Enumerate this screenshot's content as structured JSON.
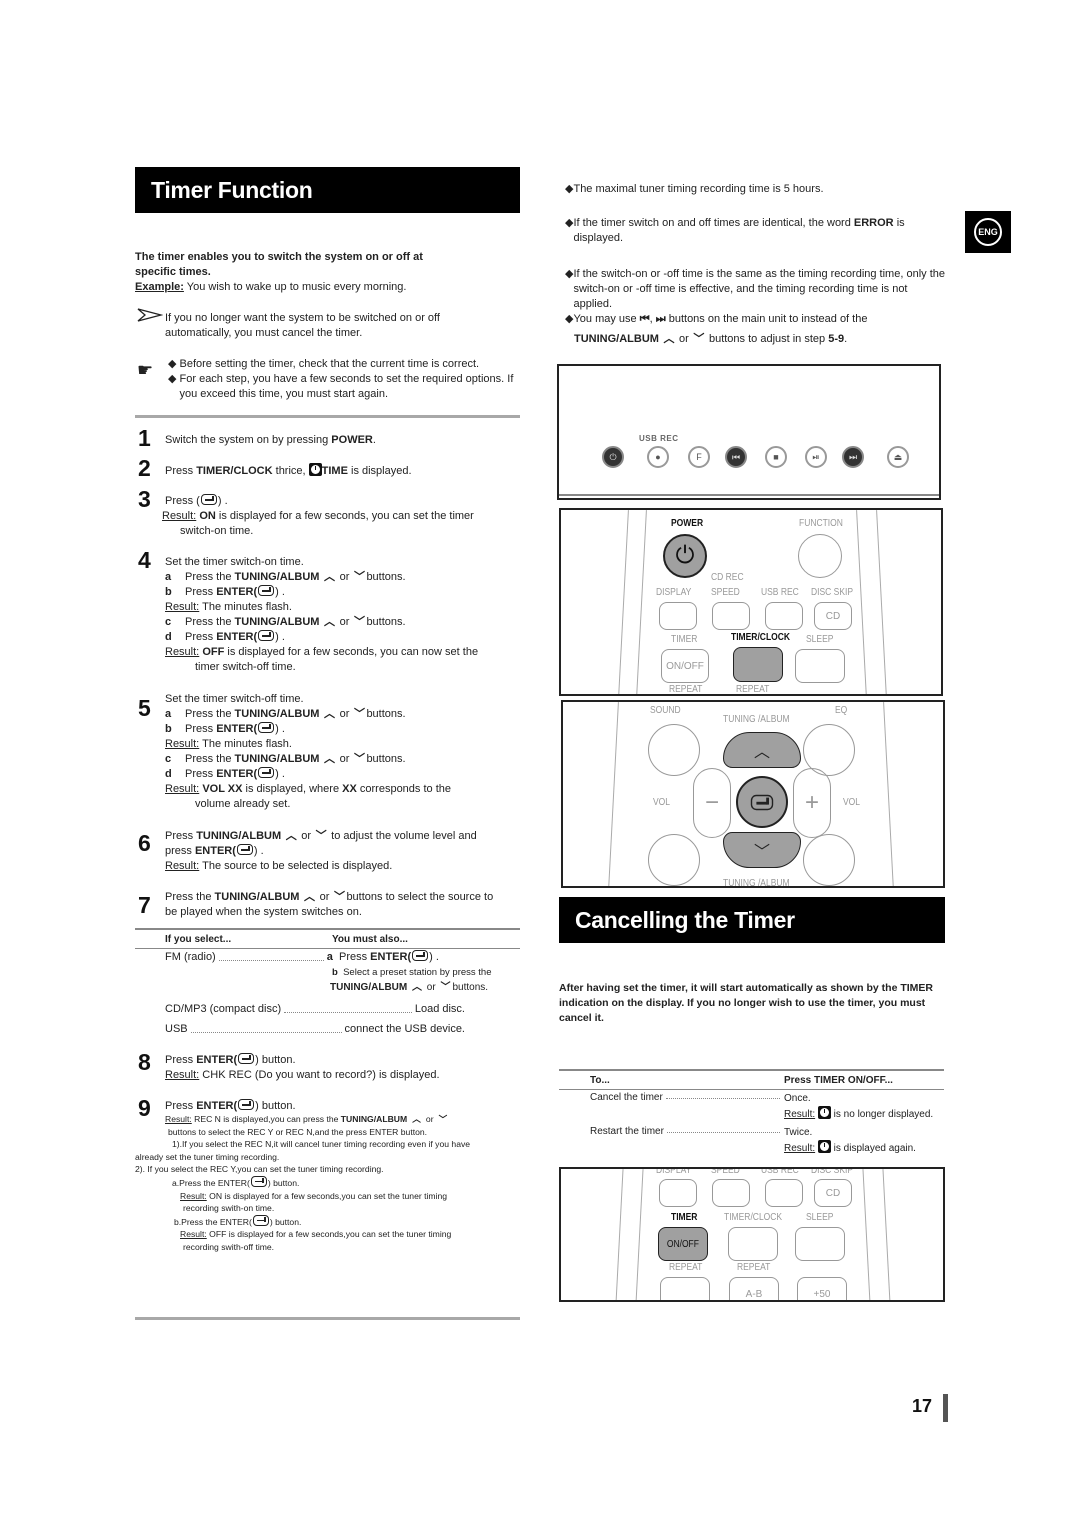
{
  "left": {
    "title": "Timer Function",
    "intro_bold": "The timer enables you to switch the system on or off at specific times.",
    "example_label": "Example:",
    "example_text": " You wish to wake up to music every morning.",
    "note_cancel": "If you no longer want the system to be switched on or off automatically, you must cancel the timer.",
    "tips": [
      "Before setting the timer, check that the current time is correct.",
      "For each step, you have a few seconds to set the required options. If you exceed this time, you must start again."
    ],
    "steps": {
      "s1": {
        "num": "1",
        "pre": "Switch the system on by pressing ",
        "bold": "POWER",
        "post": "."
      },
      "s2": {
        "num": "2",
        "pre": "Press ",
        "bold": "TIMER/CLOCK",
        "mid": " thrice, ",
        "bold2": "TIME",
        "post": " is displayed."
      },
      "s3": {
        "num": "3",
        "line1": "Press (",
        "line1b": ") .",
        "result_label": "Result:",
        "result_bold": "ON",
        "result_text": " is displayed for a few seconds, you can set the timer",
        "result_text2": "switch-on time."
      },
      "s4": {
        "num": "4",
        "title": "Set the timer switch-on time.",
        "a": {
          "letter": "a",
          "pre": "Press the ",
          "bold": "TUNING/ALBUM",
          "or": " or ",
          "post": "buttons."
        },
        "b": {
          "letter": "b",
          "pre": "Press ",
          "bold": "ENTER(",
          "post": ") ."
        },
        "res1": {
          "label": "Result:",
          "text": " The minutes flash."
        },
        "c": {
          "letter": "c",
          "pre": "Press the ",
          "bold": "TUNING/ALBUM",
          "or": " or ",
          "post": "buttons."
        },
        "d": {
          "letter": "d",
          "pre": "Press ",
          "bold": "ENTER(",
          "post": ") ."
        },
        "res2": {
          "label": "Result:",
          "bold": "OFF",
          "text": "  is displayed for a few seconds,  you can now set the",
          "text2": "timer switch-off time."
        }
      },
      "s5": {
        "num": "5",
        "title": "Set the timer switch-off time.",
        "a": {
          "letter": "a",
          "pre": "Press the ",
          "bold": "TUNING/ALBUM",
          "or": " or ",
          "post": "buttons."
        },
        "b": {
          "letter": "b",
          "pre": "Press ",
          "bold": "ENTER(",
          "post": ") ."
        },
        "res1": {
          "label": "Result:",
          "text": " The minutes flash."
        },
        "c": {
          "letter": "c",
          "pre": "Press the ",
          "bold": "TUNING/ALBUM",
          "or": " or ",
          "post": "buttons."
        },
        "d": {
          "letter": "d",
          "pre": "Press ",
          "bold": "ENTER(",
          "post": ") ."
        },
        "res2": {
          "label": "Result:",
          "bold": "VOL XX",
          "text": " is displayed, where ",
          "bold2": "XX",
          "text_b": " corresponds to the",
          "text2": "volume already set."
        }
      },
      "s6": {
        "num": "6",
        "pre": "Press ",
        "bold": "TUNING/ALBUM",
        "or": " or ",
        "post": " to adjust the volume level and",
        "line2pre": "press ",
        "line2bold": "ENTER(",
        "line2post": ") .",
        "result_label": "Result:",
        "result_text": " The source to be selected is displayed."
      },
      "s7": {
        "num": "7",
        "pre": "Press the ",
        "bold": "TUNING/ALBUM",
        "or": " or ",
        "post": "buttons to select the source to",
        "line2": "be played when the system switches on."
      },
      "s8": {
        "num": "8",
        "pre": "Press ",
        "bold": "ENTER(",
        "post": ") button.",
        "result_label": "Result:",
        "result_text": " CHK REC (Do you want to record?) is displayed."
      },
      "s9": {
        "num": "9",
        "pre": "Press ",
        "bold": "ENTER(",
        "post": ")  button.",
        "result_label": "Result:",
        "result_text": " REC N is displayed,you can press the ",
        "result_bold": "TUNING/ALBUM",
        "result_or": " or ",
        "line2": "buttons to select the REC Y or REC N,and the press ENTER button.",
        "line3": "1).If you select the REC N,it will cancel tuner timing recording even if you have",
        "line4": "already set the tuner timing recording.",
        "line5": "2). If you select the REC Y,you can set the tuner timing recording.",
        "line6pre": "a.Press the ENTER(",
        "line6post": ")  button.",
        "line7label": "Result:",
        "line7": " ON is displayed for a few seconds,you can set the tuner timing",
        "line8": "recording swith-on time.",
        "line9pre": "b.Press the ENTER(",
        "line9post": ")  button.",
        "line10label": "Result:",
        "line10": " OFF is displayed for a few seconds,you can set the tuner timing",
        "line11": "recording swith-off time."
      }
    },
    "source_table": {
      "headers": [
        "If you select...",
        "You must also..."
      ],
      "rows": [
        {
          "source": "FM (radio)",
          "a_letter": "a",
          "a_pre": "Press ",
          "a_bold": "ENTER(",
          "a_post": ") .",
          "b_letter": "b",
          "b_text": "Select a preset station by press the",
          "b_bold": "TUNING/ALBUM",
          "b_or": " or ",
          "b_post": "buttons."
        },
        {
          "source": "CD/MP3 (compact disc)",
          "action": "Load disc."
        },
        {
          "source": "USB",
          "action": "connect the USB device."
        }
      ]
    }
  },
  "right": {
    "notes": [
      "The maximal tuner timing recording time is 5 hours.",
      "If the timer switch on and off times are identical, the word ",
      "If the switch-on or -off time is the same as the timing recording time, only the switch-on or -off time is effective, and the timing recording time is not applied.",
      "You may use "
    ],
    "note2_bold": "ERROR",
    "note2_post": " is",
    "note2_line2": "displayed.",
    "note4_mid": ",",
    "note4_post": " buttons on the main unit to instead of the",
    "note4_line2_bold": "TUNING/ALBUM",
    "note4_line2_or": " or ",
    "note4_line2_post": " buttons to adjust in step ",
    "note4_line2_step": "5-9",
    "note4_line2_end": ".",
    "lang_badge": "ENG",
    "unit_panel": {
      "usb_rec_label": "USB REC",
      "buttons": [
        "power",
        "usb-rec",
        "function",
        "prev",
        "stop",
        "play-pause",
        "next",
        "eject"
      ]
    },
    "remote_top": {
      "power": "POWER",
      "function": "FUNCTION",
      "cd_rec": "CD REC",
      "display": "DISPLAY",
      "speed": "SPEED",
      "usb_rec": "USB REC",
      "disc_skip": "DISC SKIP",
      "cd": "CD",
      "timer": "TIMER",
      "on_off": "ON/OFF",
      "timer_clock": "TIMER/CLOCK",
      "sleep": "SLEEP",
      "repeat1": "REPEAT",
      "repeat2": "REPEAT"
    },
    "remote_nav": {
      "sound": "SOUND",
      "tuning_album_top": "TUNING /ALBUM",
      "eq": "EQ",
      "vol_left": "VOL",
      "vol_right": "VOL",
      "tuning_album_bottom": "TUNING /ALBUM"
    },
    "cancel_title": "Cancelling the Timer",
    "cancel_intro": "After having set the timer, it will start automatically as shown by the TIMER indication on the display. If you no longer wish to use the timer, you must cancel it.",
    "cancel_table": {
      "headers": [
        "To...",
        "Press TIMER ON/OFF..."
      ],
      "rows": [
        {
          "action": "Cancel the timer",
          "press": "Once.",
          "result_label": "Result:",
          "result_text": " is no longer displayed."
        },
        {
          "action": "Restart the timer",
          "press": "Twice.",
          "result_label": "Result:",
          "result_text": " is displayed again."
        }
      ]
    },
    "remote_bottom": {
      "display": "DISPLAY",
      "speed": "SPEED",
      "usb_rec": "USB REC",
      "disc_skip": "DISC SKIP",
      "cd": "CD",
      "timer": "TIMER",
      "on_off": "ON/OFF",
      "timer_clock": "TIMER/CLOCK",
      "sleep": "SLEEP",
      "repeat1": "REPEAT",
      "repeat2": "REPEAT",
      "ab": "A-B",
      "plus50": "+50"
    }
  },
  "footer": {
    "page_number": "17"
  }
}
